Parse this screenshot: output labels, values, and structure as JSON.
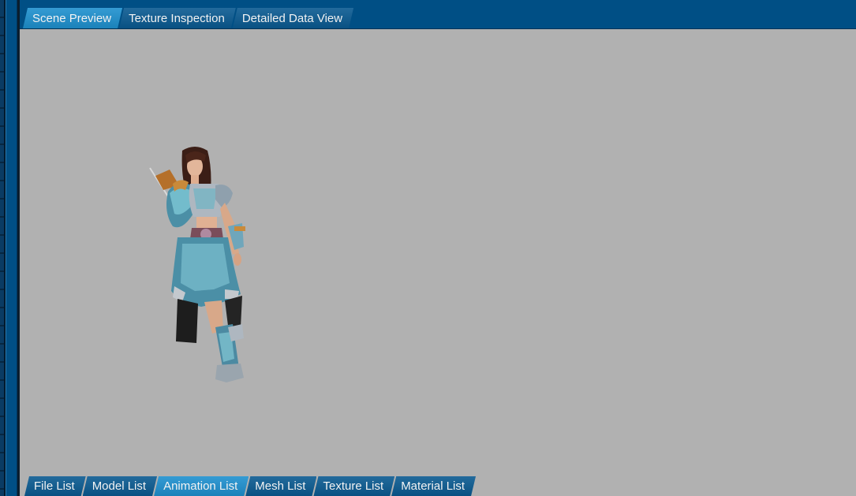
{
  "top_tabs": [
    {
      "label": "Scene Preview",
      "active": true
    },
    {
      "label": "Texture Inspection",
      "active": false
    },
    {
      "label": "Detailed Data View",
      "active": false
    }
  ],
  "bottom_tabs": [
    {
      "label": "File List",
      "active": false
    },
    {
      "label": "Model List",
      "active": false
    },
    {
      "label": "Animation List",
      "active": true
    },
    {
      "label": "Mesh List",
      "active": false
    },
    {
      "label": "Texture List",
      "active": false
    },
    {
      "label": "Material List",
      "active": false
    }
  ],
  "colors": {
    "chrome": "#004f85",
    "tab_inactive": "#0a5a91",
    "tab_active": "#1e90cf",
    "viewport_bg": "#b1b1b1"
  }
}
